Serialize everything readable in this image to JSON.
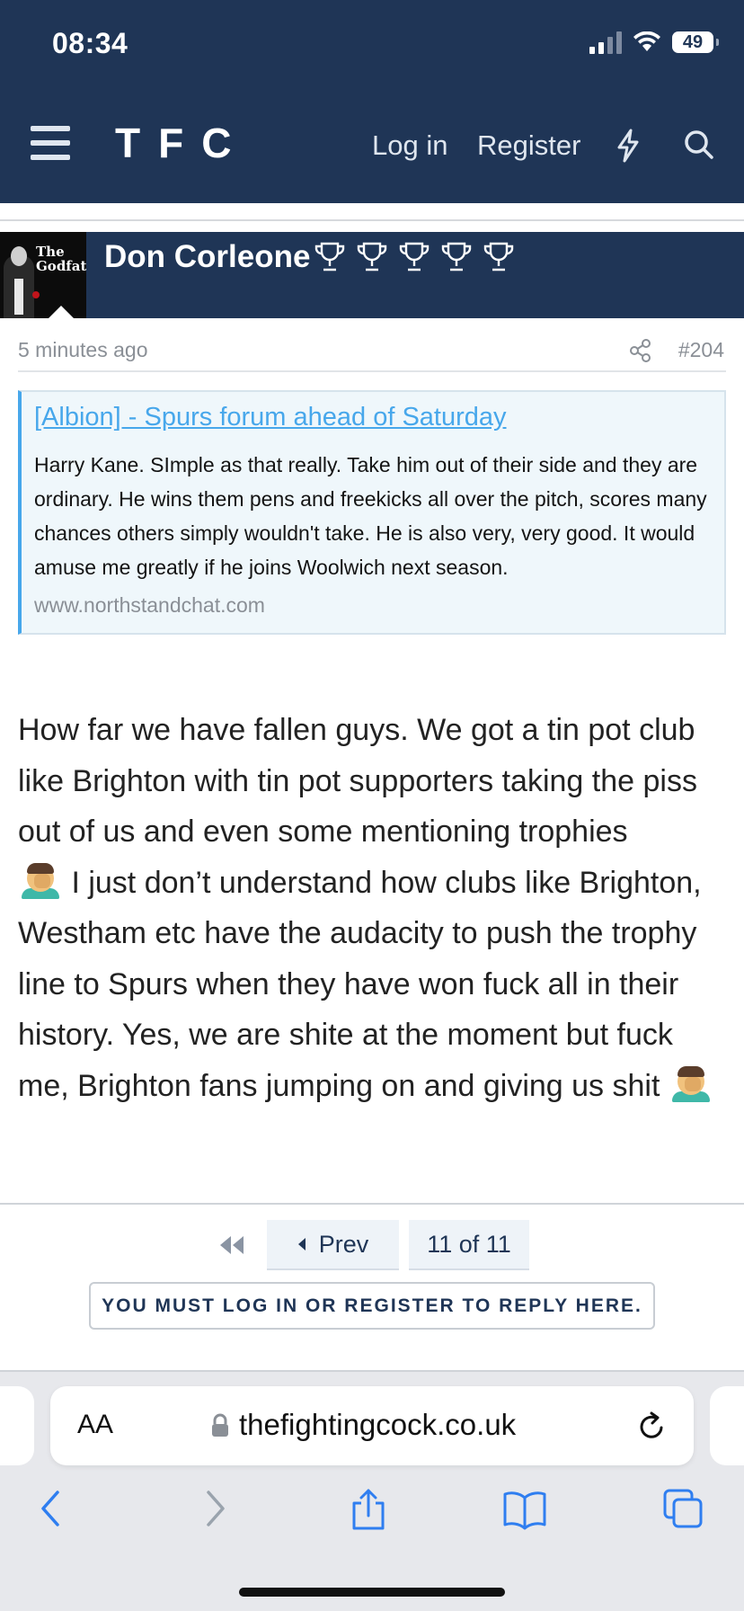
{
  "status_bar": {
    "time": "08:34",
    "battery": "49"
  },
  "site_header": {
    "logo": "TFC",
    "login_label": "Log in",
    "register_label": "Register"
  },
  "post": {
    "username": "Don Corleone",
    "avatar_text": "The Godfather",
    "time": "5 minutes ago",
    "number": "#204",
    "embed": {
      "title": "[Albion] - Spurs forum ahead of Saturday",
      "body": "Harry Kane. SImple as that really. Take him out of their side and they are ordinary. He wins them pens and freekicks all over the pitch, scores many chances others simply wouldn't take. He is also very, very good. It would amuse me greatly if he joins Woolwich next season.",
      "domain": "www.northstandchat.com"
    },
    "message_part1": "How far we have fallen guys. We got a tin pot club like Brighton with tin pot supporters taking the piss out of us and even some mentioning trophies",
    "message_part2": " I just don’t understand how clubs like Brighton, Westham etc have the audacity to push the trophy line to Spurs when they have won fuck all in their history. Yes, we are shite at the moment but fuck me, Brighton fans jumping on and giving us shit "
  },
  "pagination": {
    "prev_label": "Prev",
    "current": "11 of 11"
  },
  "reply_notice": "YOU MUST LOG IN OR REGISTER TO REPLY HERE.",
  "browser": {
    "aa_label": "AA",
    "url": "thefightingcock.co.uk"
  },
  "colors": {
    "header_bg": "#1f3556",
    "link": "#47a7eb",
    "embed_bg": "#eff7fb"
  }
}
